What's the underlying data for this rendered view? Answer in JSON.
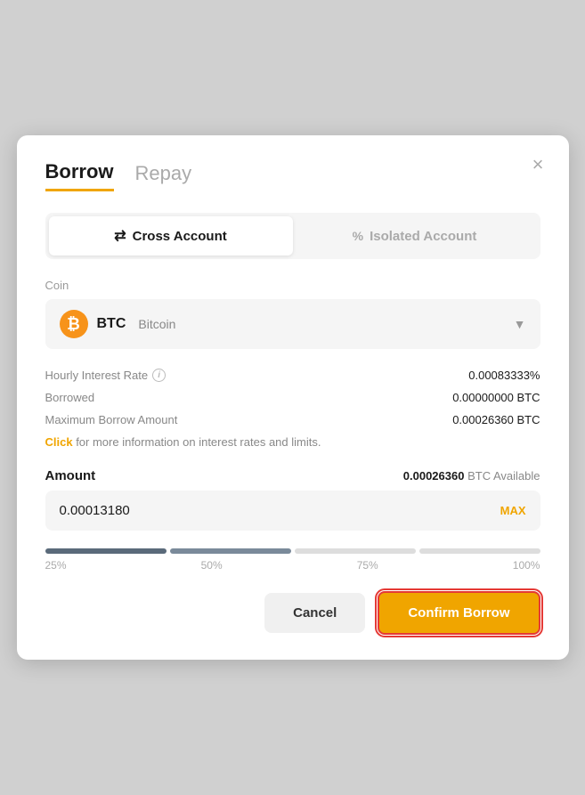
{
  "modal": {
    "title": "Borrow/Repay",
    "tab_borrow": "Borrow",
    "tab_repay": "Repay",
    "close_label": "×"
  },
  "account_toggle": {
    "cross_label": "Cross Account",
    "cross_icon": "⇄",
    "isolated_label": "Isolated Account",
    "isolated_icon": "%"
  },
  "coin_select": {
    "coin_code": "BTC",
    "coin_name": "Bitcoin",
    "symbol": "₿"
  },
  "info": {
    "hourly_rate_label": "Hourly Interest Rate",
    "hourly_rate_value": "0.00083333%",
    "borrowed_label": "Borrowed",
    "borrowed_value": "0.00000000 BTC",
    "max_borrow_label": "Maximum Borrow Amount",
    "max_borrow_value": "0.00026360 BTC",
    "click_link": "Click",
    "click_text": " for more information on interest rates and limits."
  },
  "amount": {
    "label": "Amount",
    "available_value": "0.00026360",
    "available_unit": "BTC Available",
    "input_value": "0.00013180",
    "max_label": "MAX"
  },
  "slider": {
    "labels": [
      "25%",
      "50%",
      "75%",
      "100%"
    ]
  },
  "actions": {
    "cancel_label": "Cancel",
    "confirm_label": "Confirm Borrow"
  }
}
